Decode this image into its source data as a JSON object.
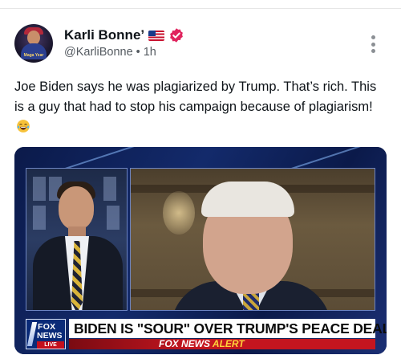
{
  "author": {
    "display_name": "Karli Bonne’",
    "handle": "@KarliBonne",
    "separator": "•",
    "time_ago": "1h",
    "avatar_text": "Maga Year",
    "badges": [
      "us-flag-icon",
      "verified-icon"
    ]
  },
  "post": {
    "text": "Joe Biden says he was plagiarized by Trump. That’s rich. This is a guy that had to stop his campaign because of plagiarism!",
    "emoji": "tears-of-joy-emoji-icon"
  },
  "media": {
    "network_logo": {
      "line1": "FOX",
      "line2": "NEWS",
      "live_label": "LIVE"
    },
    "headline": "BIDEN IS \"SOUR\" OVER TRUMP'S PEACE DEAL",
    "alert_prefix": "FOX NEWS",
    "alert_label": "ALERT"
  },
  "colors": {
    "verified_badge": "#e0245e",
    "more_icon": "#8b8f94",
    "fox_blue": "#0a2a78",
    "alert_red": "#c4151f",
    "alert_yellow": "#ffd23a"
  }
}
